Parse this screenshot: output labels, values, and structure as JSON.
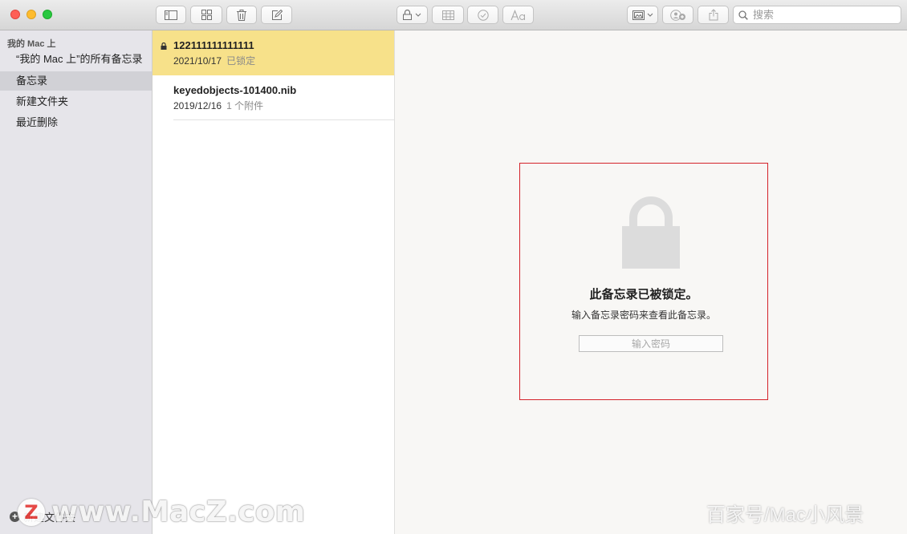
{
  "toolbar": {
    "search_placeholder": "搜索"
  },
  "sidebar": {
    "header": "我的 Mac 上",
    "items": [
      {
        "label": "“我的 Mac 上”的所有备忘录"
      },
      {
        "label": "备忘录",
        "selected": true
      },
      {
        "label": "新建文件夹"
      },
      {
        "label": "最近删除"
      }
    ],
    "footer_label": "新建文件夹"
  },
  "notes": [
    {
      "title": "122111111111111",
      "date": "2021/10/17",
      "sub": "已锁定",
      "locked": true,
      "selected": true
    },
    {
      "title": "keyedobjects-101400.nib",
      "date": "2019/12/16",
      "sub": "1 个附件",
      "locked": false,
      "selected": false
    }
  ],
  "locked_view": {
    "title": "此备忘录已被锁定。",
    "subtitle": "输入备忘录密码来查看此备忘录。",
    "password_placeholder": "输入密码"
  },
  "watermark": {
    "logo_letter": "Z",
    "left_text": "www.MacZ.com",
    "right_text": "百家号/Mac小风景"
  },
  "colors": {
    "selected_note": "#f7e18a",
    "highlight_border": "#d4232a"
  }
}
